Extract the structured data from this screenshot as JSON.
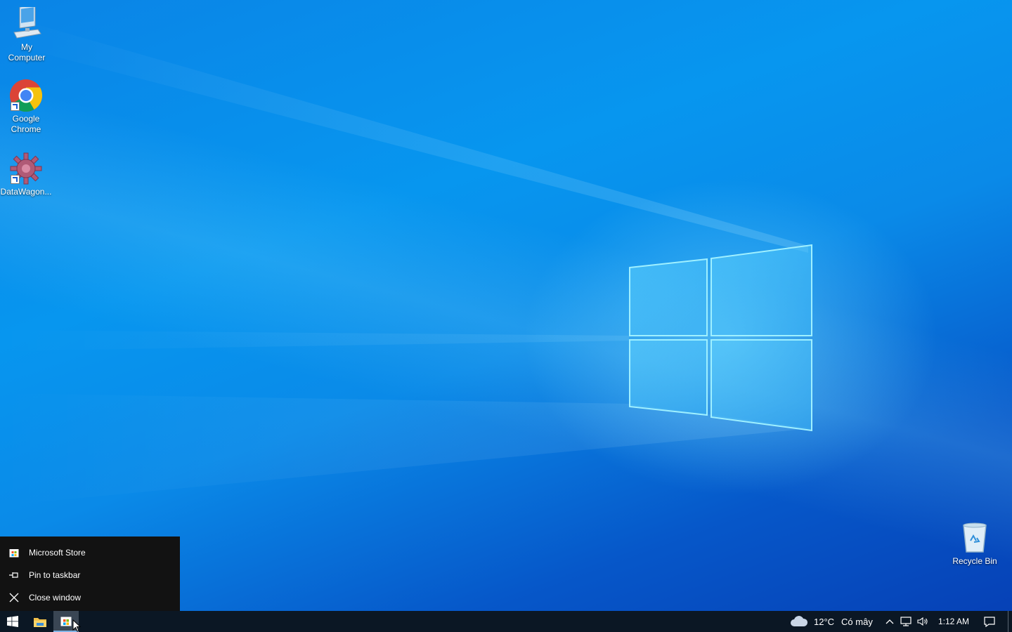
{
  "desktop": {
    "icons": [
      {
        "label_line1": "My",
        "label_line2": "Computer",
        "icon": "computer-icon"
      },
      {
        "label_line1": "Google",
        "label_line2": "Chrome",
        "icon": "chrome-icon"
      },
      {
        "label_line1": "DataWagon...",
        "label_line2": "",
        "icon": "gear-icon"
      },
      {
        "label_line1": "Recycle Bin",
        "label_line2": "",
        "icon": "recycle-bin-icon"
      }
    ]
  },
  "jumplist": {
    "app_label": "Microsoft Store",
    "pin_label": "Pin to taskbar",
    "close_label": "Close window"
  },
  "taskbar": {
    "weather_temp": "12°C",
    "weather_text": "Có mây",
    "clock": "1:12 AM",
    "colors": {
      "background": "#0b1724",
      "active_app": "#3a4654",
      "menu_background": "#121212"
    }
  }
}
